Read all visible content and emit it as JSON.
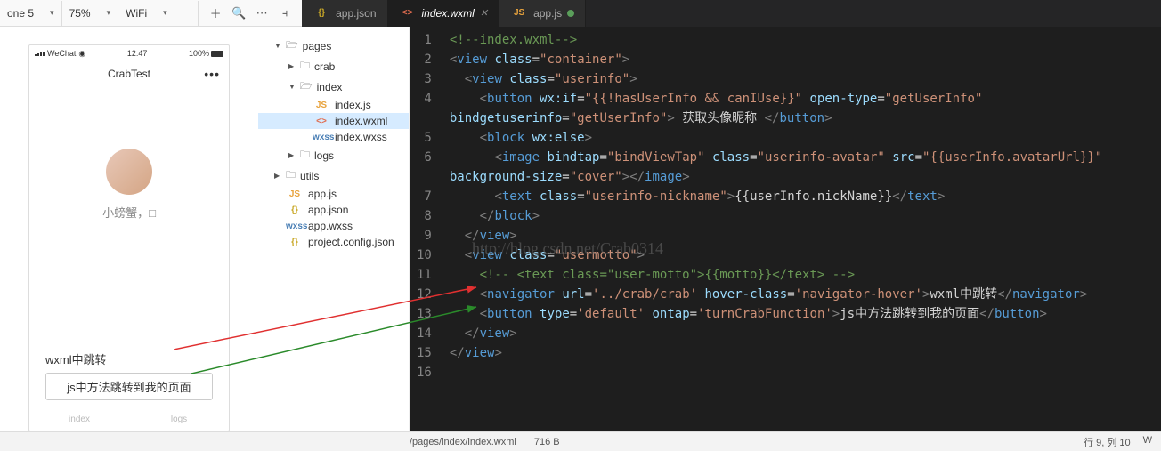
{
  "toolbar": {
    "device": "one 5",
    "zoom": "75%",
    "network": "WiFi"
  },
  "tabs": [
    {
      "label": "app.json",
      "icon": "{}",
      "modified": false
    },
    {
      "label": "index.wxml",
      "icon": "<>",
      "active": true
    },
    {
      "label": "app.js",
      "icon": "JS",
      "modified": true
    }
  ],
  "simulator": {
    "carrier": "WeChat",
    "time": "12:47",
    "battery": "100%",
    "title": "CrabTest",
    "nickname": "小螃蟹，□",
    "link_text": "wxml中跳转",
    "button_text": "js中方法跳转到我的页面",
    "tab1": "index",
    "tab2": "logs"
  },
  "tree": {
    "root": "pages",
    "items": [
      {
        "label": "crab",
        "type": "folder",
        "indent": 2,
        "caret": "▶"
      },
      {
        "label": "index",
        "type": "folder-open",
        "indent": 2,
        "caret": "▼"
      },
      {
        "label": "index.js",
        "type": "js",
        "indent": 3
      },
      {
        "label": "index.wxml",
        "type": "wxml",
        "indent": 3,
        "active": true
      },
      {
        "label": "index.wxss",
        "type": "wxss",
        "indent": 3
      },
      {
        "label": "logs",
        "type": "folder",
        "indent": 2,
        "caret": "▶"
      },
      {
        "label": "utils",
        "type": "folder",
        "indent": 1,
        "caret": "▶"
      },
      {
        "label": "app.js",
        "type": "js",
        "indent": 1,
        "nocaret": true
      },
      {
        "label": "app.json",
        "type": "json",
        "indent": 1,
        "nocaret": true
      },
      {
        "label": "app.wxss",
        "type": "wxss",
        "indent": 1,
        "nocaret": true
      },
      {
        "label": "project.config.json",
        "type": "json",
        "indent": 1,
        "nocaret": true
      }
    ]
  },
  "code": {
    "line1_comment": "<!--index.wxml-->",
    "button_text": "获取头像昵称",
    "nav_text": "wxml中跳转",
    "btn_text": "js中方法跳转到我的页面",
    "attrs": {
      "container": "\"container\"",
      "userinfo": "\"userinfo\"",
      "wxif": "\"{{!hasUserInfo && canIUse}}\"",
      "opentype": "\"getUserInfo\"",
      "bindget": "\"getUserInfo\"",
      "bindtap": "\"bindViewTap\"",
      "avatar": "\"userinfo-avatar\"",
      "src": "\"{{userInfo.avatarUrl}}\"",
      "cover": "\"cover\"",
      "nick": "\"userinfo-nickname\"",
      "nickexpr": "{{userInfo.nickName}}",
      "usermotto": "\"usermotto\"",
      "motto_comment": "<!-- <text class=\"user-motto\">{{motto}}</text> -->",
      "navurl": "'../crab/crab'",
      "navhover": "'navigator-hover'",
      "btntype": "'default'",
      "ontap": "'turnCrabFunction'"
    }
  },
  "watermark": "http://blog.csdn.net/Crab0314",
  "status": {
    "path": "/pages/index/index.wxml",
    "size": "716 B",
    "pos": "行 9, 列 10",
    "mode": "W"
  }
}
